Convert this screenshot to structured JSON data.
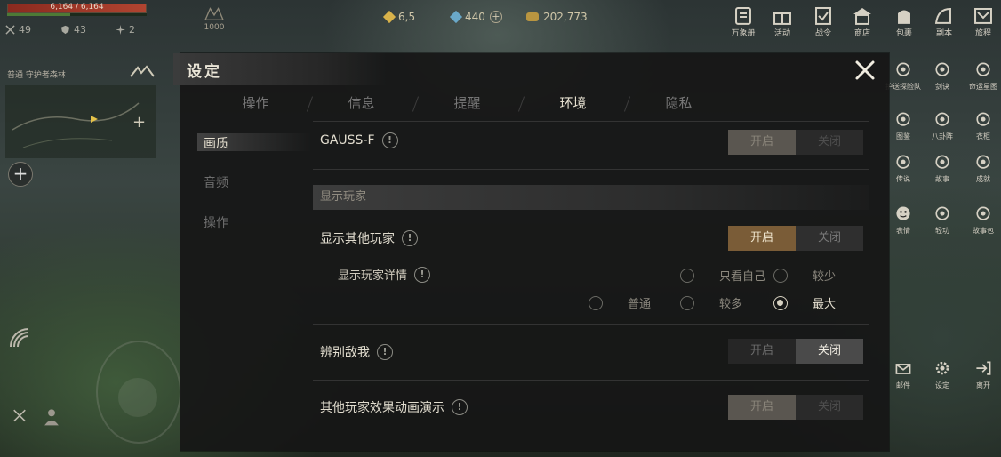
{
  "hud": {
    "hp_text": "6,164 / 6,164",
    "hp_ratio": 1.0,
    "xp_ratio": 0.45,
    "stats": {
      "attack": "49",
      "defense": "43",
      "speed": "2"
    },
    "level": "1000",
    "currency": {
      "gems": "6,5",
      "jade": "440",
      "coins": "202,773"
    },
    "map_label": "普通  守护者森林",
    "map_plus": "+",
    "zoom_plus": "+"
  },
  "top_menu": [
    {
      "icon": "catalog-icon",
      "label": "万象册"
    },
    {
      "icon": "gift-icon",
      "label": "活动"
    },
    {
      "icon": "pass-icon",
      "label": "战令"
    },
    {
      "icon": "shop-icon",
      "label": "商店"
    },
    {
      "icon": "bag-icon",
      "label": "包裹"
    },
    {
      "icon": "dungeon-icon",
      "label": "副本"
    },
    {
      "icon": "journey-icon",
      "label": "旅程"
    }
  ],
  "side_menu": [
    {
      "icon": "escort-icon",
      "label": "护送探险队"
    },
    {
      "icon": "sword-icon",
      "label": "剑诀"
    },
    {
      "icon": "fate-icon",
      "label": "命运星图"
    },
    {
      "icon": "atlas-icon",
      "label": "图鉴"
    },
    {
      "icon": "bagua-icon",
      "label": "八卦阵"
    },
    {
      "icon": "wardrobe-icon",
      "label": "衣柜"
    },
    {
      "icon": "legend-icon",
      "label": "传说"
    },
    {
      "icon": "story-icon",
      "label": "故事"
    },
    {
      "icon": "achievement-icon",
      "label": "成就"
    },
    {
      "icon": "emote-icon",
      "label": "表情"
    },
    {
      "icon": "light-skill-icon",
      "label": "轻功"
    },
    {
      "icon": "storybook-icon",
      "label": "故事包"
    },
    {
      "icon": "mail-icon",
      "label": "邮件"
    },
    {
      "icon": "settings-icon",
      "label": "设定"
    },
    {
      "icon": "exit-icon",
      "label": "离开"
    }
  ],
  "settings": {
    "title": "设定",
    "tabs": [
      "操作",
      "信息",
      "提醒",
      "环境",
      "隐私"
    ],
    "active_tab": 3,
    "subnav": [
      "画质",
      "音频",
      "操作"
    ],
    "active_subnav": 0,
    "gauss": {
      "label": "GAUSS-F",
      "on": "开启",
      "off": "关闭"
    },
    "section_show_players": "显示玩家",
    "show_other_players": {
      "label": "显示其他玩家",
      "on": "开启",
      "off": "关闭"
    },
    "player_details": {
      "label": "显示玩家详情",
      "options": [
        "只看自己",
        "较少",
        "普通",
        "较多",
        "最大"
      ],
      "selected": "最大"
    },
    "identify_enemy": {
      "label": "辨别敌我",
      "on": "开启",
      "off": "关闭"
    },
    "other_effects": {
      "label": "其他玩家效果动画演示",
      "on": "开启",
      "off": "关闭"
    }
  },
  "colors": {
    "accent_on": "#7a5c37",
    "panel_bg": "#161616",
    "hp": "#b04430"
  }
}
